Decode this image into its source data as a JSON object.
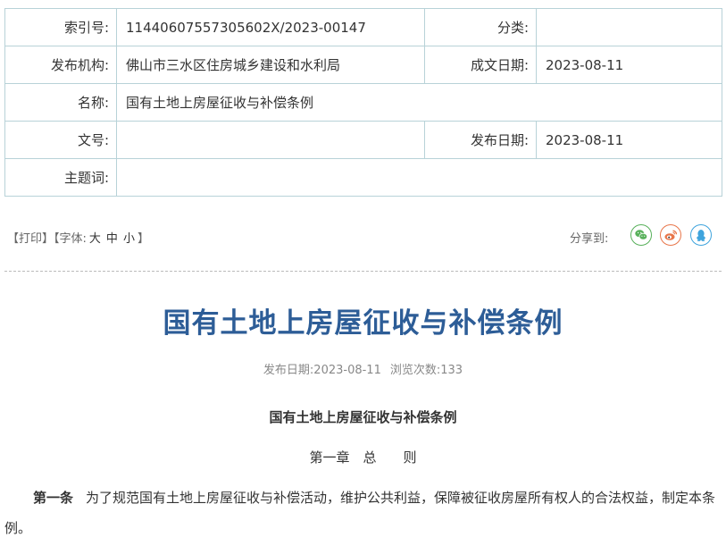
{
  "meta": {
    "index_label": "索引号:",
    "index_value": "11440607557305602X/2023-00147",
    "category_label": "分类:",
    "category_value": "",
    "publisher_label": "发布机构:",
    "publisher_value": "佛山市三水区住房城乡建设和水利局",
    "written_date_label": "成文日期:",
    "written_date_value": "2023-08-11",
    "name_label": "名称:",
    "name_value": "国有土地上房屋征收与补偿条例",
    "docno_label": "文号:",
    "docno_value": "",
    "publish_date_label": "发布日期:",
    "publish_date_value": "2023-08-11",
    "keywords_label": "主题词:",
    "keywords_value": ""
  },
  "toolbar": {
    "print": "【打印】",
    "font_prefix": "【字体:",
    "font_large": "大",
    "font_medium": "中",
    "font_small": "小",
    "font_suffix": "】",
    "share_label": "分享到:"
  },
  "article": {
    "title": "国有土地上房屋征收与补偿条例",
    "publish_info": "发布日期:2023-08-11",
    "views_info": "浏览次数:133",
    "subtitle": "国有土地上房屋征收与补偿条例",
    "chapter": "第一章　总　　则",
    "article_label": "第一条",
    "article_text": "为了规范国有土地上房屋征收与补偿活动，维护公共利益，保障被征收房屋所有权人的合法权益，制定本条例。"
  },
  "colors": {
    "title": "#2d5d97",
    "border": "#b8d2d8",
    "wechat": "#58b05b",
    "weibo": "#e8764a",
    "qq": "#3fa4dd"
  },
  "icons": [
    "wechat-icon",
    "weibo-icon",
    "qq-icon"
  ]
}
